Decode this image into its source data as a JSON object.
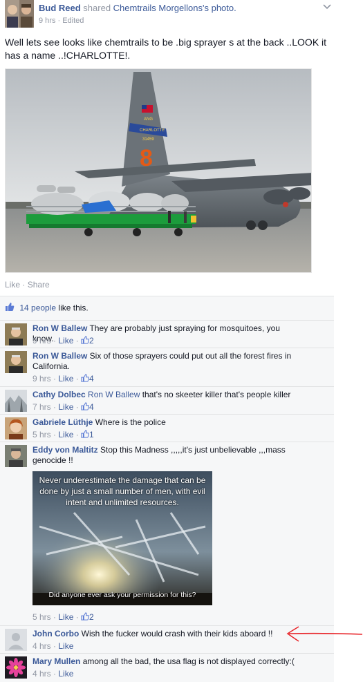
{
  "post": {
    "author": "Bud Reed",
    "shared_text": "shared",
    "page_name": "Chemtrails Morgellons's photo.",
    "meta": "9 hrs · Edited",
    "text": "Well lets see looks like chemtrails to be .big sprayer s at the back ..LOOK it has a name ..!CHARLOTTE!.",
    "photo_labels": {
      "unit": "ANG",
      "name": "CHARLOTTE",
      "serial": "31459",
      "number": "8"
    },
    "actions": {
      "like": "Like",
      "separator": " · ",
      "share": "Share"
    }
  },
  "likes": {
    "count_link": "14 people",
    "suffix": " like this."
  },
  "comments": [
    {
      "author": "Ron W Ballew",
      "text": " They are probably just spraying for mosquitoes, you know.",
      "time": "9 hrs",
      "like": "Like",
      "likes": "2"
    },
    {
      "author": "Ron W Ballew",
      "text": " Six of those sprayers could put out all the forest fires in California.",
      "time": "9 hrs",
      "like": "Like",
      "likes": "4"
    },
    {
      "author": "Cathy Dolbec",
      "tag": "Ron W Ballew",
      "text": " that's no skeeter killer that's people killer",
      "time": "7 hrs",
      "like": "Like",
      "likes": "4"
    },
    {
      "author": "Gabriele Lüthje",
      "text": " Where is the police",
      "time": "5 hrs",
      "like": "Like",
      "likes": "1"
    },
    {
      "author": "Eddy von Maltitz",
      "text": " Stop this Madness ,,,,,it's just unbelievable ,,,mass genocide !!",
      "time": "5 hrs",
      "like": "Like",
      "likes": "2",
      "image_top_text": "Never underestimate the damage that can be done by just a small number of men, with evil intent and unlimited resources.",
      "image_bottom_text": "Did anyone ever ask your permission for this?"
    },
    {
      "author": "John Corbo",
      "text": " Wish the fucker would crash with their kids aboard !!",
      "time": "4 hrs",
      "like": "Like"
    },
    {
      "author": "Mary Mullen",
      "text": " among all the bad, the usa flag is not displayed correctly:(",
      "time": "4 hrs",
      "like": "Like"
    }
  ],
  "colors": {
    "link": "#3b5998",
    "muted": "#9197a3",
    "ufi_background": "#f6f7f8",
    "annotation": "#e8262b"
  },
  "icons": [
    "chevron-down-icon",
    "thumbs-up-icon",
    "red-arrow-annotation"
  ]
}
